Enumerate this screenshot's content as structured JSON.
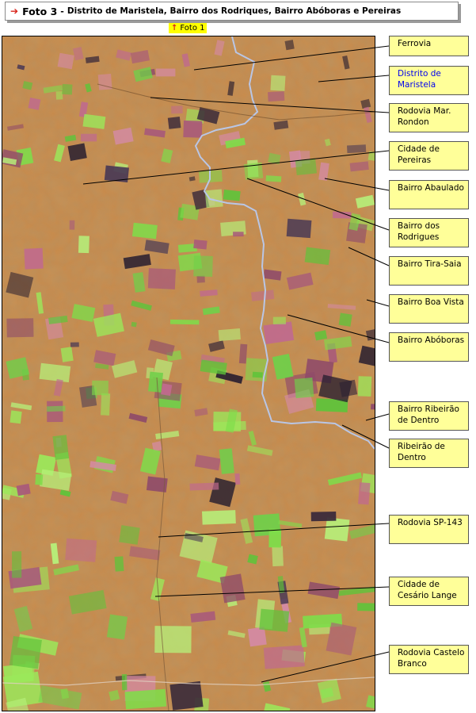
{
  "title": {
    "arrow_icon": "right-arrow-icon",
    "main": "Foto 3",
    "separator": "-",
    "subtitle": "Distrito de Maristela, Bairro dos Rodriques, Bairro Abóboras e Pereiras"
  },
  "foto_link": {
    "icon": "up-arrow-icon",
    "label": "Foto 1"
  },
  "labels": [
    {
      "text": "Ferrovia",
      "link": false
    },
    {
      "text": "Distrito de Maristela",
      "link": true
    },
    {
      "text": "Rodovia Mar. Rondon",
      "link": false
    },
    {
      "text": "Cidade de Pereiras",
      "link": false
    },
    {
      "text": "Bairro Abaulado",
      "link": false
    },
    {
      "text": "Bairro dos Rodrigues",
      "link": false
    },
    {
      "text": "Bairro Tira-Saia",
      "link": false
    },
    {
      "text": "Bairro Boa Vista",
      "link": false
    },
    {
      "text": "Bairro Abóboras",
      "link": false
    },
    {
      "text": "Bairro Ribeirão de Dentro",
      "link": false
    },
    {
      "text": "Ribeirão de Dentro",
      "link": false
    },
    {
      "text": "Rodovia SP-143",
      "link": false
    },
    {
      "text": "Cidade de Cesário Lange",
      "link": false
    },
    {
      "text": "Rodovia Castelo Branco",
      "link": false
    }
  ],
  "colors": {
    "label_bg": "#ffff99",
    "highlight": "#ffff00",
    "link": "#0000ee",
    "terrain": "#c98a4a",
    "vegetation": "#7fdc4a",
    "fields_pink": "#c06a8e",
    "river": "#b9c6e6"
  }
}
